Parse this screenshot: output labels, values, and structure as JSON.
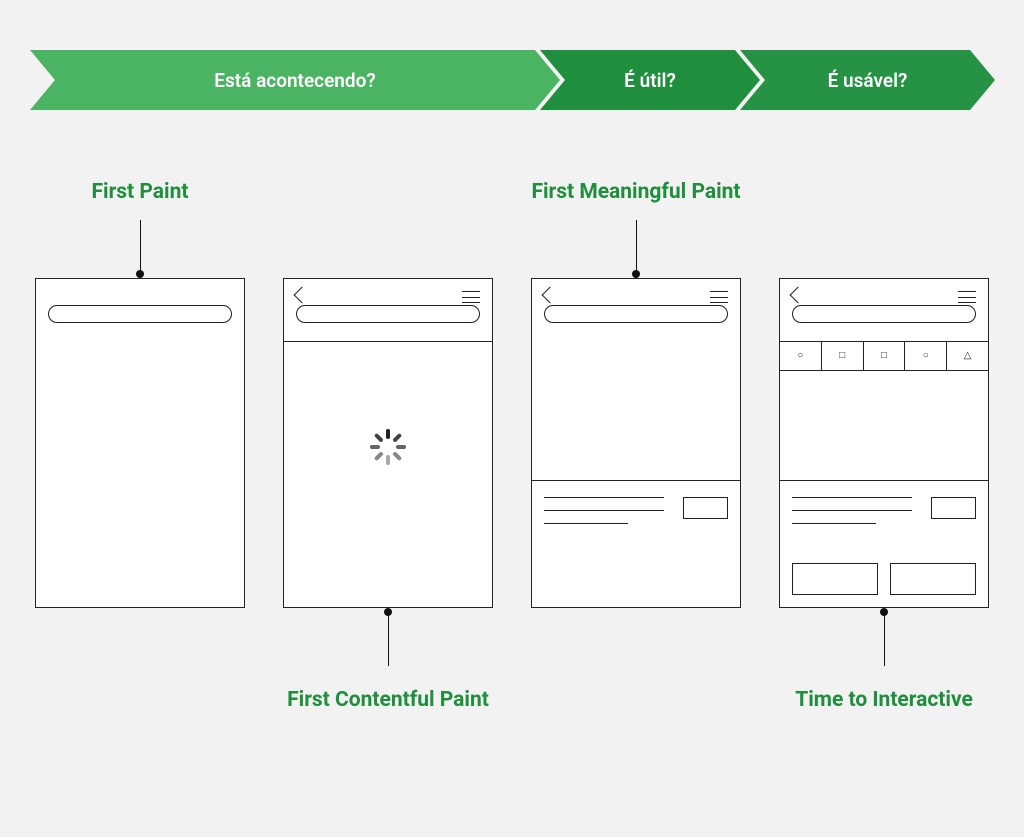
{
  "chevrons": {
    "happening": "Está acontecendo?",
    "useful": "É útil?",
    "usable": "É usável?"
  },
  "metrics": {
    "first_paint": "First Paint",
    "first_contentful_paint": "First Contentful Paint",
    "first_meaningful_paint": "First Meaningful Paint",
    "time_to_interactive": "Time to Interactive"
  },
  "colors": {
    "chevron_light": "#4bb462",
    "chevron_dark": "#1f8e3d",
    "label": "#1f8e3d"
  }
}
